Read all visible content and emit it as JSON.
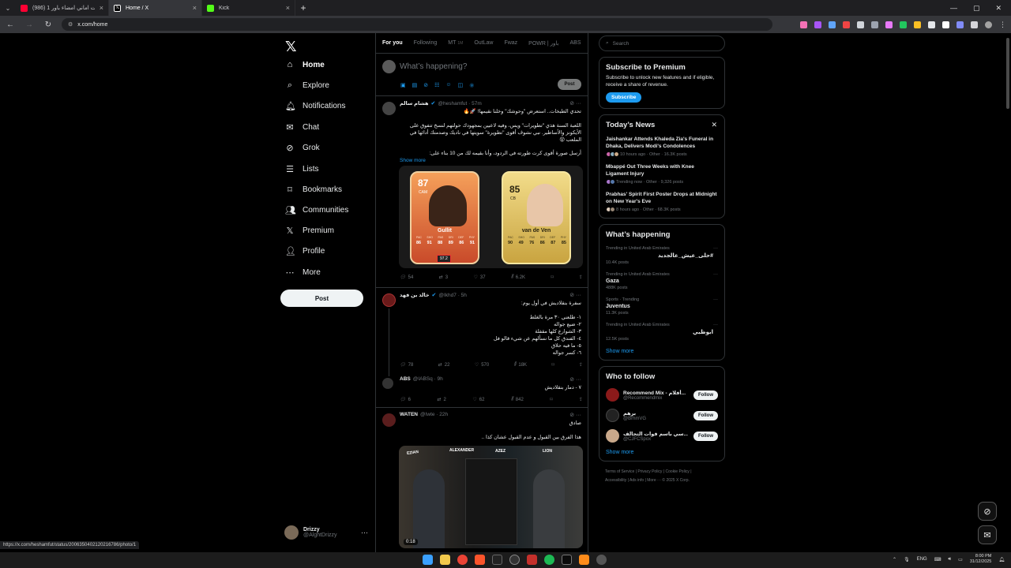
{
  "browser": {
    "tabs": [
      {
        "title": "(986) حقشت اماني امضاء باور 1 ?",
        "color": "#ff0033"
      },
      {
        "title": "Home / X",
        "color": "#ffffff"
      },
      {
        "title": "Kick",
        "color": "#53fc18"
      }
    ],
    "url": "x.com/home",
    "status_url": "https://x.com/heshamfut/status/2006350402120216786/photo/1"
  },
  "nav": {
    "items": [
      {
        "label": "Home",
        "icon": "home-icon"
      },
      {
        "label": "Explore",
        "icon": "search-icon"
      },
      {
        "label": "Notifications",
        "icon": "bell-icon"
      },
      {
        "label": "Chat",
        "icon": "mail-icon"
      },
      {
        "label": "Grok",
        "icon": "grok-icon"
      },
      {
        "label": "Lists",
        "icon": "list-icon"
      },
      {
        "label": "Bookmarks",
        "icon": "bookmark-icon"
      },
      {
        "label": "Communities",
        "icon": "people-icon"
      },
      {
        "label": "Premium",
        "icon": "x-icon"
      },
      {
        "label": "Profile",
        "icon": "person-icon"
      },
      {
        "label": "More",
        "icon": "more-circle-icon"
      }
    ],
    "post_label": "Post",
    "user": {
      "name": "Drizzy",
      "handle": "@AlghtDrizzy"
    }
  },
  "feed": {
    "tabs": [
      {
        "label": "For you",
        "active": true,
        "sub": ""
      },
      {
        "label": "Following",
        "sub": ""
      },
      {
        "label": "MT",
        "sub": "1M"
      },
      {
        "label": "OutLaw",
        "sub": ""
      },
      {
        "label": "Fwaz",
        "sub": ""
      },
      {
        "label": "POWR | باور",
        "sub": ""
      },
      {
        "label": "ABS",
        "sub": ""
      }
    ],
    "composer": {
      "placeholder": "What’s happening?",
      "post_label": "Post"
    },
    "tweet1": {
      "name": "هشام سالم",
      "handle": "@heshamfut · 57m",
      "lines": [
        "تحدي الطبخات.. استعرض \"وحوشك\" وخلنا نقيمها! 🚀🔥",
        "اللعبة السنة هذي \"تطويرات\" ويس، وفيه لاعبين بمجهودك حولتهم لنسخ تتفوق على الأيكونز والأساطير. نبي نشوف أقوى \"تطويرة\" سويتها في ناديك وصدمتك أدائها في الملعب 😲",
        "أرسل صورة أقوى كرت طورته في الردود، وأنا بقيمه لك من 10 بناء على:"
      ],
      "show_more": "Show more",
      "card_left": {
        "rating": "87",
        "position": "CAM",
        "name": "Gullit",
        "stats": [
          "86",
          "91",
          "88",
          "89",
          "86",
          "91"
        ],
        "badge": "97.2"
      },
      "card_right": {
        "rating": "85",
        "position": "CB",
        "name": "van de Ven",
        "stats": [
          "90",
          "49",
          "76",
          "86",
          "87",
          "85"
        ]
      },
      "stat_keys": [
        "PAC",
        "SHO",
        "PAS",
        "DRI",
        "DEF",
        "PHY"
      ],
      "replies": "54",
      "reposts": "3",
      "likes": "37",
      "views": "6.2K"
    },
    "tweet2": {
      "name": "خالد بن فهد",
      "handle": "@Ikhd7 · 5h",
      "lines": [
        "سفرة بنقلاديش في أول يوم:",
        "١- طلعني ٣٠ مرة بالغلط",
        "٢- ضيع جواله",
        "٣- الشوارع كلها مقفلة",
        "٤- الفندق كل ما نسألهم عن شيء قالو فل",
        "٥- ما فيه حلاق",
        "٦- كسر جواله"
      ],
      "replies": "78",
      "reposts": "22",
      "likes": "570",
      "views": "18K"
    },
    "tweet3": {
      "name": "ABS",
      "handle": "@IABSq · 9h",
      "lines": [
        "٧ - دمار بنقلاديش"
      ],
      "replies": "6",
      "reposts": "2",
      "likes": "62",
      "views": "842"
    },
    "tweet4": {
      "name": "WATEN",
      "handle": "@Iwte · 22h",
      "lines": [
        "صادق",
        "هذا الفرق بين القبول و عدم القبول عشان كذا .."
      ],
      "video_time": "0:18",
      "video_names": [
        "EZIAN",
        "ALEXANDER",
        "AZEZ",
        "LION"
      ]
    }
  },
  "right": {
    "search_placeholder": "Search",
    "premium": {
      "title": "Subscribe to Premium",
      "body": "Subscribe to unlock new features and if eligible, receive a share of revenue.",
      "button": "Subscribe"
    },
    "news": {
      "title": "Today’s News",
      "items": [
        {
          "title": "Jaishankar Attends Khaleda Zia's Funeral in Dhaka, Delivers Modi's Condolences",
          "meta": "10 hours ago · Other · 16.3K posts"
        },
        {
          "title": "Mbappé Out Three Weeks with Knee Ligament Injury",
          "meta": "Trending now · Other · 9,326 posts"
        },
        {
          "title": "Prabhas' Spirit First Poster Drops at Midnight on New Year's Eve",
          "meta": "8 hours ago · Other · 68.3K posts"
        }
      ]
    },
    "happening": {
      "title": "What’s happening",
      "trends": [
        {
          "context": "Trending in United Arab Emirates",
          "topic": "#حلى_عيش_عالجديد",
          "posts": "10.4K posts",
          "rtl": true
        },
        {
          "context": "Trending in United Arab Emirates",
          "topic": "Gaza",
          "posts": "488K posts",
          "rtl": false
        },
        {
          "context": "Sports · Trending",
          "topic": "Juventus",
          "posts": "11.3K posts",
          "rtl": false
        },
        {
          "context": "Trending in United Arab Emirates",
          "topic": "ابوظبي",
          "posts": "12.5K posts",
          "rtl": true
        }
      ],
      "show_more": "Show more"
    },
    "who_to_follow": {
      "title": "Who to follow",
      "users": [
        {
          "name": "Recommend Mix - أفلام...",
          "handle": "@Recommendmix",
          "color": "#8b1a1a"
        },
        {
          "name": "برهم",
          "handle": "@BrhmVG",
          "color": "#222"
        },
        {
          "name": "سي باسم فوات التحالف...",
          "handle": "@CJFCSpox",
          "color": "#c9a88a"
        }
      ],
      "follow_label": "Follow",
      "show_more": "Show more"
    },
    "footer": [
      "Terms of Service",
      "Privacy Policy",
      "Cookie Policy",
      "Accessibility",
      "Ads info",
      "More ···",
      "© 2025 X Corp."
    ]
  },
  "taskbar": {
    "lang": "ENG",
    "time": "8:00 PM",
    "date": "31/12/2025"
  }
}
